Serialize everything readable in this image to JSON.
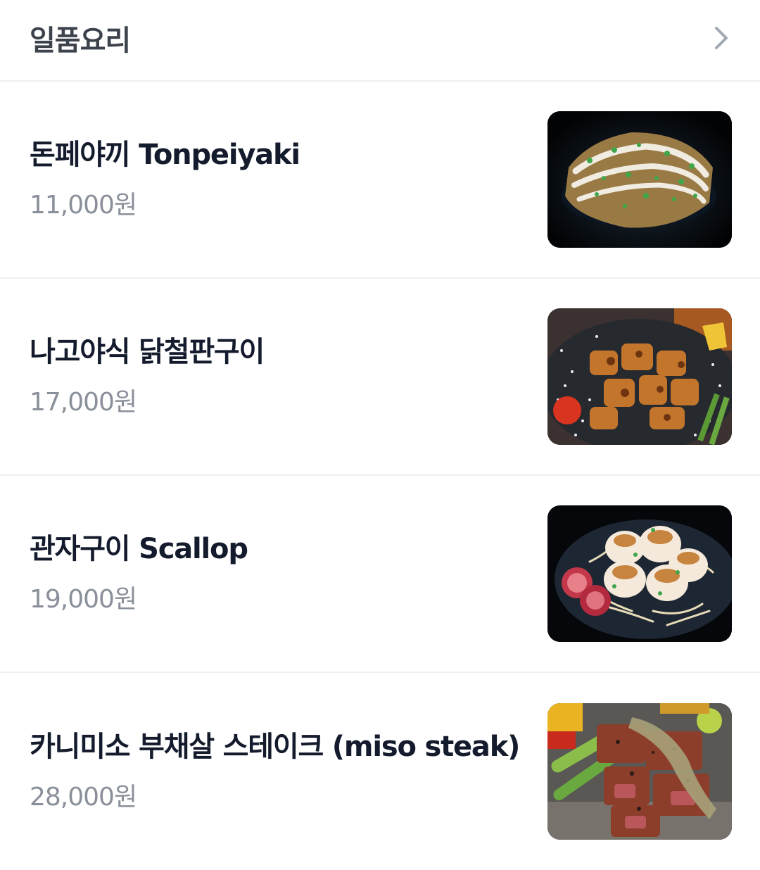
{
  "header": {
    "title": "일품요리",
    "chevron_icon": "chevron-right-icon"
  },
  "items": [
    {
      "name": "돈페야끼 Tonpeiyaki",
      "price": "11,000원"
    },
    {
      "name": "나고야식 닭철판구이",
      "price": "17,000원"
    },
    {
      "name": "관자구이 Scallop",
      "price": "19,000원"
    },
    {
      "name": "카니미소 부채살 스테이크 (miso steak)",
      "price": "28,000원"
    }
  ],
  "colors": {
    "title": "#141b2d",
    "price": "#8a909a",
    "divider": "#eef0f3"
  }
}
